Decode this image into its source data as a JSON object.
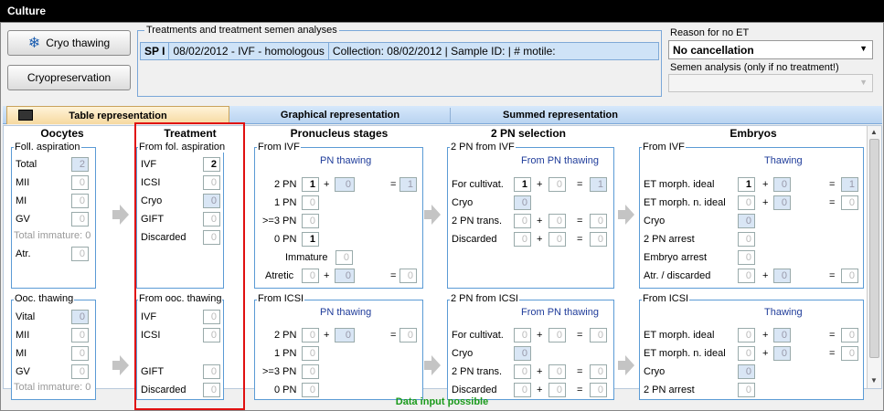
{
  "window": {
    "title": "Culture"
  },
  "buttons": {
    "cryo_thawing": "Cryo thawing",
    "cryopreservation": "Cryopreservation"
  },
  "treatments": {
    "group_label": "Treatments and treatment semen analyses",
    "row": {
      "code": "SP I",
      "desc": "08/02/2012 - IVF - homologous",
      "collection": "Collection: 08/02/2012 | Sample ID:  | # motile:"
    }
  },
  "reason": {
    "label": "Reason for no ET",
    "value": "No cancellation",
    "semen_label": "Semen analysis (only if no treatment!)",
    "semen_value": ""
  },
  "tabs": [
    "Table representation",
    "Graphical representation",
    "Summed representation"
  ],
  "columns": {
    "oocytes": "Oocytes",
    "treatment": "Treatment",
    "pronucleus": "Pronucleus stages",
    "selection": "2 PN selection",
    "embryos": "Embryos"
  },
  "oocytes_fol": {
    "title": "Foll. aspiration",
    "total": "Total",
    "total_v": "2",
    "mii": "MII",
    "mii_v": "0",
    "mi": "MI",
    "mi_v": "0",
    "gv": "GV",
    "gv_v": "0",
    "immature": "Total immature: 0",
    "atr": "Atr.",
    "atr_v": "0"
  },
  "oocytes_occ": {
    "title": "Ooc. thawing",
    "vital": "Vital",
    "vital_v": "0",
    "mii": "MII",
    "mii_v": "0",
    "mi": "MI",
    "mi_v": "0",
    "gv": "GV",
    "gv_v": "0",
    "immature": "Total immature: 0"
  },
  "treat_fol": {
    "title": "From fol. aspiration",
    "ivf": "IVF",
    "ivf_v": "2",
    "icsi": "ICSI",
    "icsi_v": "0",
    "cryo": "Cryo",
    "cryo_v": "0",
    "gift": "GIFT",
    "gift_v": "0",
    "disc": "Discarded",
    "disc_v": "0"
  },
  "treat_occ": {
    "title": "From ooc. thawing",
    "ivf": "IVF",
    "ivf_v": "0",
    "icsi": "ICSI",
    "icsi_v": "0",
    "gift": "GIFT",
    "gift_v": "0",
    "disc": "Discarded",
    "disc_v": "0"
  },
  "pn_ivf": {
    "title": "From IVF",
    "sub": "PN thawing",
    "pn2": "2 PN",
    "pn2_a": "1",
    "pn2_b": "0",
    "pn2_s": "1",
    "pn1": "1 PN",
    "pn1_v": "0",
    "pn3": ">=3 PN",
    "pn3_v": "0",
    "pn0": "0 PN",
    "pn0_v": "1",
    "imm": "Immature",
    "imm_v": "0",
    "atr": "Atretic",
    "atr_a": "0",
    "atr_b": "0",
    "atr_s": "0"
  },
  "pn_icsi": {
    "title": "From ICSI",
    "sub": "PN thawing",
    "pn2": "2 PN",
    "pn2_a": "0",
    "pn2_b": "0",
    "pn2_s": "0",
    "pn1": "1 PN",
    "pn1_v": "0",
    "pn3": ">=3 PN",
    "pn3_v": "0",
    "pn0": "0 PN",
    "pn0_v": "0"
  },
  "sel_ivf": {
    "title": "2 PN from IVF",
    "sub": "From PN thawing",
    "cult": "For cultivat.",
    "cult_a": "1",
    "cult_b": "0",
    "cult_s": "1",
    "cryo": "Cryo",
    "cryo_v": "0",
    "trans": "2 PN trans.",
    "trans_a": "0",
    "trans_b": "0",
    "trans_s": "0",
    "disc": "Discarded",
    "disc_a": "0",
    "disc_b": "0",
    "disc_s": "0"
  },
  "sel_icsi": {
    "title": "2 PN from ICSI",
    "sub": "From PN thawing",
    "cult": "For cultivat.",
    "cult_a": "0",
    "cult_b": "0",
    "cult_s": "0",
    "cryo": "Cryo",
    "cryo_v": "0",
    "trans": "2 PN trans.",
    "trans_a": "0",
    "trans_b": "0",
    "trans_s": "0",
    "disc": "Discarded",
    "disc_a": "0",
    "disc_b": "0",
    "disc_s": "0"
  },
  "emb_ivf": {
    "title": "From IVF",
    "sub": "Thawing",
    "ideal": "ET morph. ideal",
    "ideal_a": "1",
    "ideal_b": "0",
    "ideal_s": "1",
    "nideal": "ET morph. n. ideal",
    "nideal_a": "0",
    "nideal_b": "0",
    "nideal_s": "0",
    "cryo": "Cryo",
    "cryo_v": "0",
    "arrest2": "2 PN arrest",
    "arrest2_v": "0",
    "earrest": "Embryo arrest",
    "earrest_v": "0",
    "atrd": "Atr. / discarded",
    "atrd_a": "0",
    "atrd_b": "0",
    "atrd_s": "0"
  },
  "emb_icsi": {
    "title": "From ICSI",
    "sub": "Thawing",
    "ideal": "ET morph. ideal",
    "ideal_a": "0",
    "ideal_b": "0",
    "ideal_s": "0",
    "nideal": "ET morph. n. ideal",
    "nideal_a": "0",
    "nideal_b": "0",
    "nideal_s": "0",
    "cryo": "Cryo",
    "cryo_v": "0",
    "arrest2": "2 PN arrest",
    "arrest2_v": "0"
  },
  "ops": {
    "plus": "+",
    "eq": "="
  },
  "status": "Data input possible"
}
